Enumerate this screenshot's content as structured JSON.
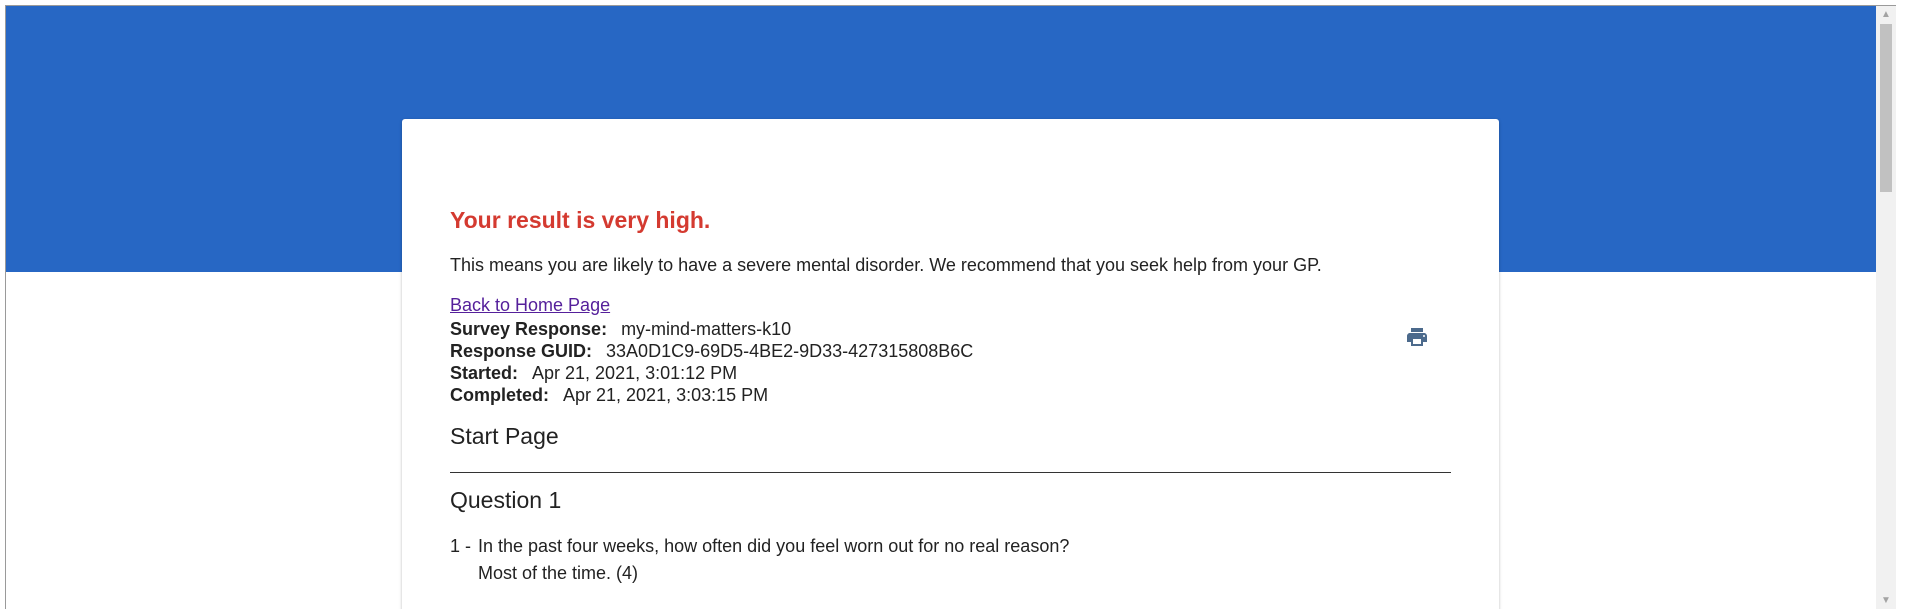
{
  "result": {
    "title": "Your result is very high.",
    "description": "This means you are likely to have a severe mental disorder. We recommend that you seek help from your GP.",
    "back_link": "Back to Home Page"
  },
  "meta": {
    "survey_response_label": "Survey Response:",
    "survey_response_value": "my-mind-matters-k10",
    "guid_label": "Response GUID:",
    "guid_value": "33A0D1C9-69D5-4BE2-9D33-427315808B6C",
    "started_label": "Started:",
    "started_value": "Apr 21, 2021, 3:01:12 PM",
    "completed_label": "Completed:",
    "completed_value": "Apr 21, 2021, 3:03:15 PM"
  },
  "section": {
    "title": "Start Page"
  },
  "question": {
    "title": "Question 1",
    "number": "1 -",
    "text": "In the past four weeks, how often did you feel worn out for no real reason?",
    "answer": "Most of the time. (4)"
  },
  "icons": {
    "print": "print-icon"
  },
  "colors": {
    "header_blue": "#2767c4",
    "result_red": "#d43a30",
    "link_purple": "#55209b"
  }
}
